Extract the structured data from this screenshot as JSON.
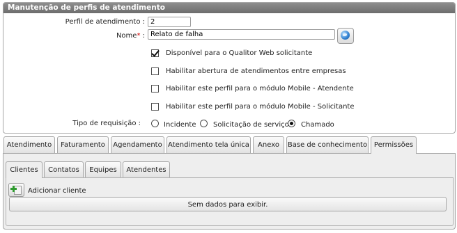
{
  "panel": {
    "title": "Manutenção de perfis de atendimento"
  },
  "form": {
    "perfil_label": "Perfil de atendimento :",
    "perfil_value": "2",
    "nome_label": "Nome",
    "nome_required": "*",
    "nome_colon": ":",
    "nome_value": "Relato de falha",
    "globe_icon": "globe-icon",
    "checkboxes": [
      {
        "label": "Disponível para o Qualitor Web solicitante",
        "checked": true
      },
      {
        "label": "Habilitar abertura de atendimentos entre empresas",
        "checked": false
      },
      {
        "label": "Habilitar este perfil para o módulo Mobile - Atendente",
        "checked": false
      },
      {
        "label": "Habilitar este perfil para o módulo Mobile - Solicitante",
        "checked": false
      }
    ],
    "tipo_label": "Tipo de requisição :",
    "tipo_options": [
      {
        "label": "Incidente",
        "selected": false
      },
      {
        "label": "Solicitação de serviço",
        "selected": false
      },
      {
        "label": "Chamado",
        "selected": true
      }
    ]
  },
  "tabs": [
    {
      "label": "Atendimento",
      "active": false
    },
    {
      "label": "Faturamento",
      "active": false
    },
    {
      "label": "Agendamento",
      "active": false
    },
    {
      "label": "Atendimento tela única",
      "active": false
    },
    {
      "label": "Anexo",
      "active": false
    },
    {
      "label": "Base de conhecimento",
      "active": false
    },
    {
      "label": "Permissões",
      "active": true
    }
  ],
  "subtabs": [
    {
      "label": "Clientes",
      "active": true
    },
    {
      "label": "Contatos",
      "active": false
    },
    {
      "label": "Equipes",
      "active": false
    },
    {
      "label": "Atendentes",
      "active": false
    }
  ],
  "clientes": {
    "add_label": "Adicionar cliente",
    "add_icon": "add-document-icon",
    "empty_text": "Sem dados para exibir."
  }
}
